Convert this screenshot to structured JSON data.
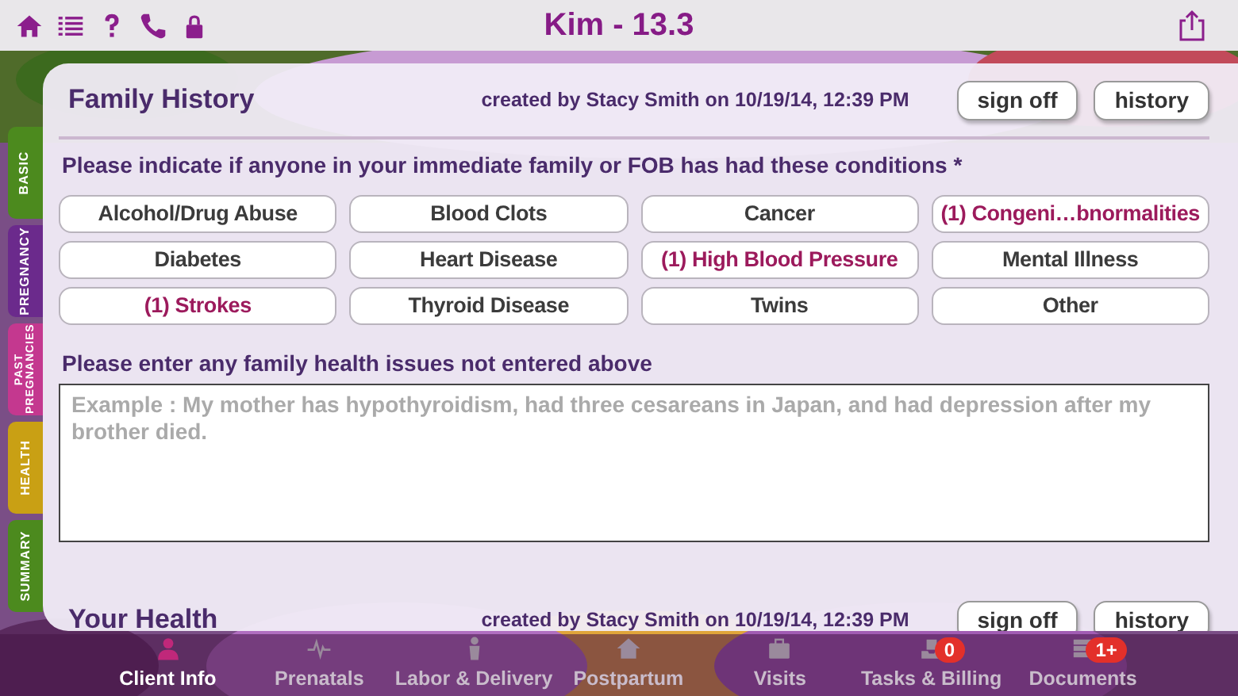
{
  "top_bar": {
    "title": "Kim - 13.3"
  },
  "side_tabs": [
    {
      "label": "BASIC",
      "color": "#4c8a1e"
    },
    {
      "label": "PREGNANCY",
      "color": "#6b2a8c"
    },
    {
      "label": "PAST PREGNANCIES",
      "color": "#c4388f"
    },
    {
      "label": "HEALTH",
      "color": "#c9a014"
    },
    {
      "label": "SUMMARY",
      "color": "#4c8a1e"
    }
  ],
  "sections": [
    {
      "title": "Family History",
      "created": "created by Stacy Smith on 10/19/14, 12:39 PM",
      "buttons": [
        "sign off",
        "history"
      ],
      "prompt": "Please indicate if anyone in your immediate family or FOB has had these conditions *",
      "conditions": [
        {
          "label": "Alcohol/Drug Abuse",
          "flagged": false
        },
        {
          "label": "Blood Clots",
          "flagged": false
        },
        {
          "label": "Cancer",
          "flagged": false
        },
        {
          "label": "(1) Congeni…bnormalities",
          "flagged": true
        },
        {
          "label": "Diabetes",
          "flagged": false
        },
        {
          "label": "Heart Disease",
          "flagged": false
        },
        {
          "label": "(1) High Blood Pressure",
          "flagged": true
        },
        {
          "label": "Mental Illness",
          "flagged": false
        },
        {
          "label": "(1) Strokes",
          "flagged": true
        },
        {
          "label": "Thyroid Disease",
          "flagged": false
        },
        {
          "label": "Twins",
          "flagged": false
        },
        {
          "label": "Other",
          "flagged": false
        }
      ],
      "notes_label": "Please enter any family health issues not entered above",
      "notes_placeholder": "Example : My mother has hypothyroidism, had three cesareans in Japan, and had depression after my brother died."
    },
    {
      "title": "Your Health",
      "created": "created by Stacy Smith on 10/19/14, 12:39 PM",
      "buttons": [
        "sign off",
        "history"
      ]
    }
  ],
  "tab_bar": [
    {
      "label": "Client Info",
      "selected": true
    },
    {
      "label": "Prenatals",
      "selected": false
    },
    {
      "label": "Labor & Delivery",
      "selected": false
    },
    {
      "label": "Postpartum",
      "selected": false
    },
    {
      "label": "Visits",
      "selected": false
    },
    {
      "label": "Tasks & Billing",
      "selected": false,
      "badge": "0"
    },
    {
      "label": "Documents",
      "selected": false,
      "badge": "1+"
    }
  ]
}
